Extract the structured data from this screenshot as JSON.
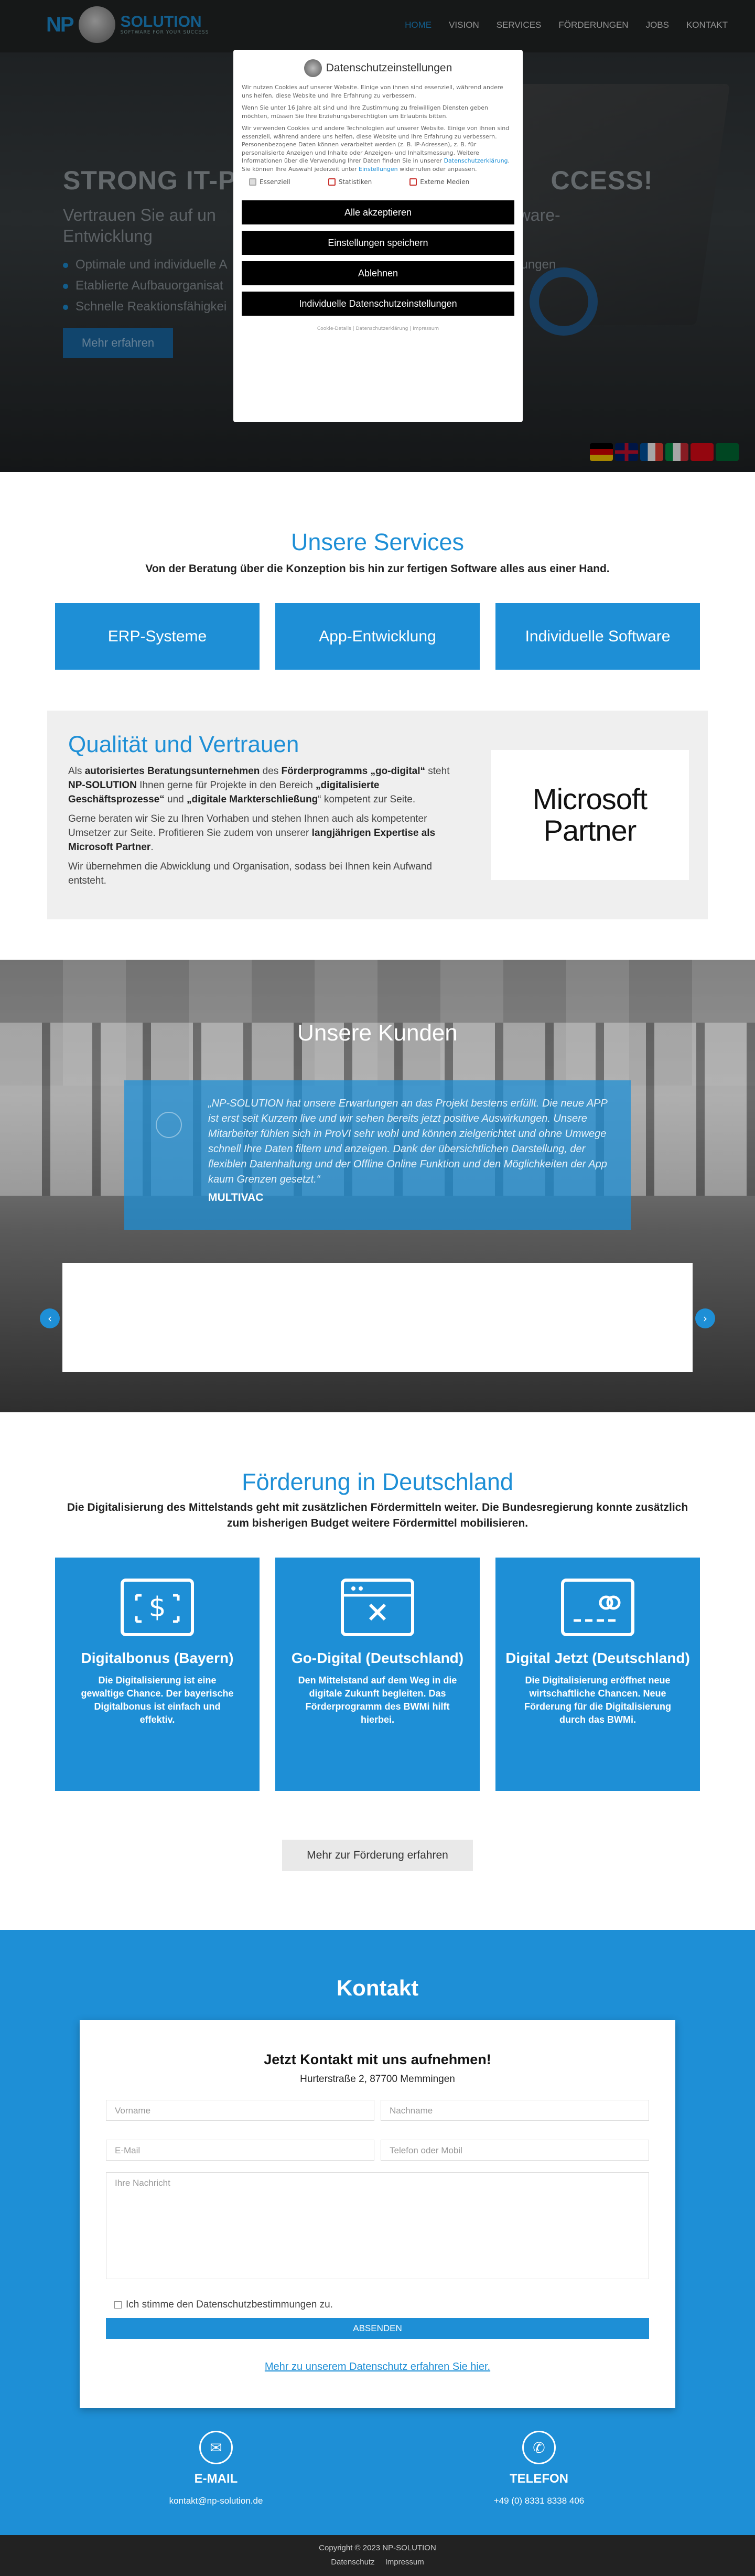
{
  "brand": {
    "np": "NP",
    "name": "SOLUTION",
    "tagline": "SOFTWARE FOR YOUR SUCCESS"
  },
  "nav": [
    "HOME",
    "VISION",
    "SERVICES",
    "FÖRDERUNGEN",
    "JOBS",
    "KONTAKT"
  ],
  "hero": {
    "title": "STRONG IT-P",
    "title_end": "CCESS!",
    "subtitle": "Vertrauen Sie auf un",
    "subtitle_end": "Software-",
    "subtitle2": "Entwicklung",
    "bullets": [
      "Optimale und individuelle A",
      "Etablierte Aufbauorganisat",
      "Schnelle Reaktionsfähigkei"
    ],
    "bullet1_end": "ungen",
    "button": "Mehr erfahren"
  },
  "cookie": {
    "title": "Datenschutzeinstellungen",
    "p1": "Wir nutzen Cookies auf unserer Website. Einige von ihnen sind essenziell, während andere uns helfen, diese Website und Ihre Erfahrung zu verbessern.",
    "p2": "Wenn Sie unter 16 Jahre alt sind und Ihre Zustimmung zu freiwilligen Diensten geben möchten, müssen Sie Ihre Erziehungsberechtigten um Erlaubnis bitten.",
    "p3": "Wir verwenden Cookies und andere Technologien auf unserer Website. Einige von ihnen sind essenziell, während andere uns helfen, diese Website und Ihre Erfahrung zu verbessern. Personenbezogene Daten können verarbeitet werden (z. B. IP-Adressen), z. B. für personalisierte Anzeigen und Inhalte oder Anzeigen- und Inhaltsmessung. Weitere Informationen über die Verwendung Ihrer Daten finden Sie in unserer",
    "p3_link": "Datenschutzerklärung",
    "p3_end": ". Sie können Ihre Auswahl jederzeit unter",
    "p3_link2": "Einstellungen",
    "p3_end2": "widerrufen oder anpassen.",
    "checks": [
      "Essenziell",
      "Statistiken",
      "Externe Medien"
    ],
    "buttons": [
      "Alle akzeptieren",
      "Einstellungen speichern",
      "Ablehnen",
      "Individuelle Datenschutzeinstellungen"
    ],
    "links": "Cookie-Details | Datenschutzerklärung | Impressum"
  },
  "services": {
    "title": "Unsere Services",
    "subtitle": "Von der Beratung über die Konzeption bis hin zur fertigen Software alles aus einer Hand.",
    "items": [
      "ERP-Systeme",
      "App-Entwicklung",
      "Individuelle Software"
    ]
  },
  "quality": {
    "title": "Qualität und Vertrauen",
    "p1a": "Als ",
    "p1b": "autorisiertes Beratungsunternehmen",
    "p1c": " des ",
    "p1d": "Förderprogramms „go-digital“",
    "p1e": " steht ",
    "p1f": "NP-SOLUTION",
    "p1g": " Ihnen gerne für Projekte in den Bereich ",
    "p1h": "„digitalisierte Geschäftsprozesse“",
    "p1i": " und ",
    "p1j": "„digitale Markterschließung",
    "p1k": "“ kompetent zur Seite.",
    "p2a": "Gerne beraten wir Sie zu Ihren Vorhaben und stehen Ihnen auch als kompetenter Umsetzer zur Seite. Profitieren Sie zudem von unserer ",
    "p2b": "langjährigen Expertise als Microsoft Partner",
    ".": ".",
    "p2c": ".",
    "p3": "Wir übernehmen die Abwicklung und Organisation, sodass bei Ihnen kein Aufwand entsteht.",
    "logo_line1": "Microsoft",
    "logo_line2": "Partner"
  },
  "kunden": {
    "title": "Unsere Kunden",
    "quote": "„NP-SOLUTION hat unsere Erwartungen an das Projekt bestens erfüllt. Die neue APP ist erst seit Kurzem live und wir sehen bereits jetzt positive Auswirkungen. Unsere Mitarbeiter fühlen sich in ProVI sehr wohl und können zielgerichtet und ohne Umwege schnell Ihre Daten filtern und anzeigen. Dank der übersichtlichen Darstellung, der flexiblen Datenhaltung und der Offline Online Funktion und den Möglichkeiten der App kaum Grenzen gesetzt.“",
    "author": "MULTIVAC",
    "prev": "‹",
    "next": "›"
  },
  "foerderung": {
    "title": "Förderung in Deutschland",
    "subtitle": "Die Digitalisierung des Mittelstands geht mit zusätzlichen Fördermitteln weiter. Die Bundesregierung konnte zusätzlich zum bisherigen Budget weitere Fördermittel mobilisieren.",
    "items": [
      {
        "title": "Digitalbonus (Bayern)",
        "text": "Die Digitalisierung ist eine gewaltige Chance. Der bayerische Digitalbonus ist einfach und effektiv."
      },
      {
        "title": "Go-Digital (Deutschland)",
        "text": "Den Mittelstand auf dem Weg in die digitale Zukunft begleiten. Das Förderprogramm des BWMi hilft hierbei."
      },
      {
        "title": "Digital Jetzt (Deutschland)",
        "text": "Die Digitalisierung eröffnet neue wirtschaftliche Chancen. Neue Förderung für die Digitalisierung durch das BWMi."
      }
    ],
    "button": "Mehr zur Förderung erfahren"
  },
  "kontakt": {
    "title": "Kontakt",
    "form_title": "Jetzt Kontakt mit uns aufnehmen!",
    "address": "Hurterstraße 2, 87700 Memmingen",
    "placeholders": {
      "vorname": "Vorname",
      "nachname": "Nachname",
      "email": "E-Mail",
      "telefon": "Telefon oder Mobil",
      "nachricht": "Ihre Nachricht"
    },
    "consent": "Ich stimme den Datenschutzbestimmungen zu.",
    "send": "ABSENDEN",
    "privacy_link": "Mehr zu unserem Datenschutz erfahren Sie hier.",
    "email_label": "E-MAIL",
    "email": "kontakt@np-solution.de",
    "phone_label": "TELEFON",
    "phone": "+49 (0) 8331 8338 406"
  },
  "footer": {
    "copyright": "Copyright © 2023 NP-SOLUTION",
    "links": [
      "Datenschutz",
      "Impressum"
    ]
  }
}
